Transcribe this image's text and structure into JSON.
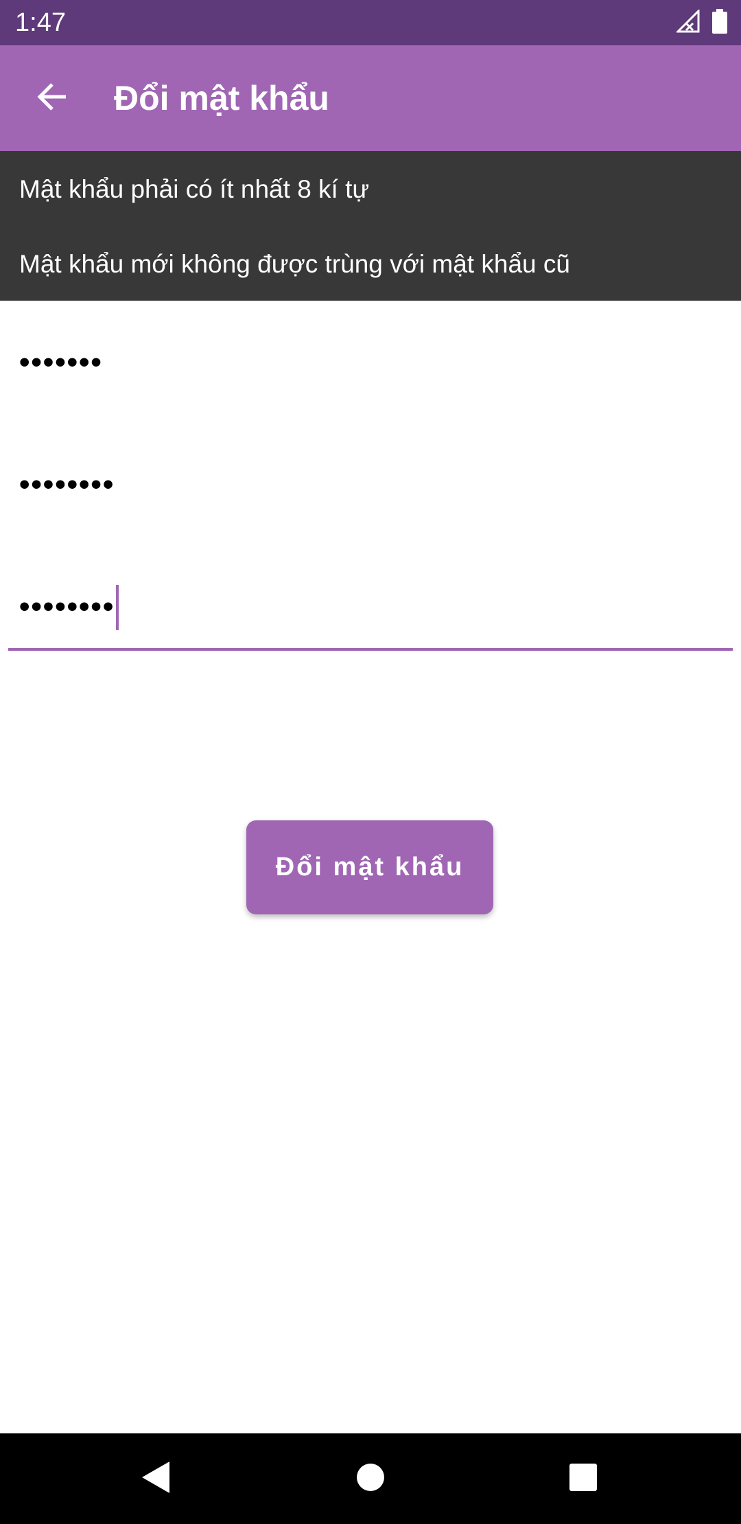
{
  "status_bar": {
    "time": "1:47",
    "icons": [
      "signal-icon",
      "battery-icon"
    ]
  },
  "app_bar": {
    "back_icon": "arrow-back-icon",
    "title": "Đổi mật khẩu"
  },
  "rules": {
    "items": [
      "Mật khẩu phải có ít nhất 8 kí tự",
      "Mật khẩu mới không được trùng với mật khẩu cũ"
    ]
  },
  "fields": {
    "old_password": "•••••••",
    "new_password": "••••••••",
    "confirm_password": "••••••••"
  },
  "button": {
    "label": "Đổi mật khẩu"
  },
  "nav_bar": {
    "icons": [
      "nav-back-icon",
      "nav-home-icon",
      "nav-recents-icon"
    ]
  },
  "colors": {
    "status_bar": "#5f3a7a",
    "app_bar": "#a066b4",
    "rules_panel": "#383838",
    "accent": "#a066b4"
  }
}
